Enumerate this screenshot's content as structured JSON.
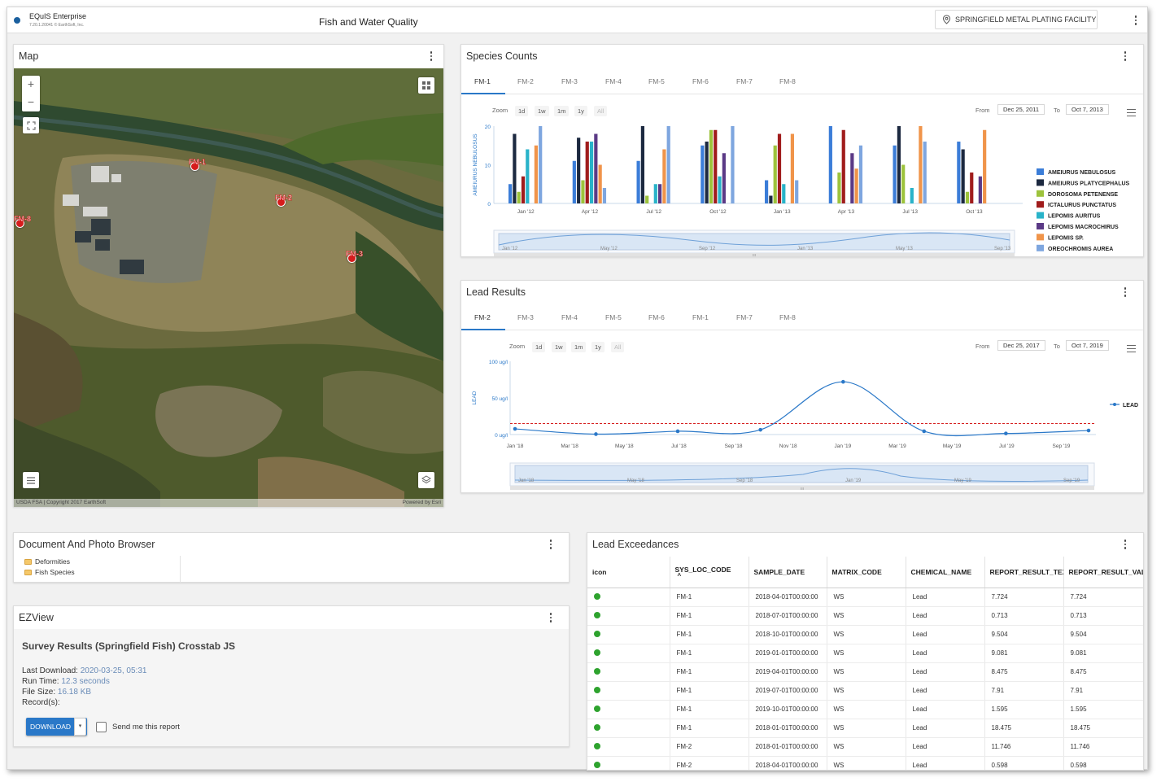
{
  "header": {
    "app_name": "EQuIS Enterprise",
    "app_version": "7.20.1.20041 © EarthSoft, Inc.",
    "page_title": "Fish and Water Quality",
    "facility": "SPRINGFIELD METAL PLATING FACILITY"
  },
  "map": {
    "title": "Map",
    "attribution_left": "USDA FSA | Copyright 2017 EarthSoft",
    "attribution_right": "Powered by Esri",
    "zoom_in": "+",
    "zoom_out": "−",
    "markers": [
      "FM-1",
      "FM-2",
      "FM-3",
      "FM-8"
    ]
  },
  "species": {
    "title": "Species Counts",
    "tabs": [
      "FM-1",
      "FM-2",
      "FM-3",
      "FM-4",
      "FM-5",
      "FM-6",
      "FM-7",
      "FM-8"
    ],
    "zoom_label": "Zoom",
    "zoom_buttons": [
      "1d",
      "1w",
      "1m",
      "1y",
      "All"
    ],
    "from_label": "From",
    "from_date": "Dec 25, 2011",
    "to_label": "To",
    "to_date": "Oct 7, 2013",
    "navigator_labels": [
      "Jan '12",
      "May '12",
      "Sep '12",
      "Jan '13",
      "May '13",
      "Sep '13"
    ],
    "navigator_scroll_label": "III"
  },
  "lead": {
    "title": "Lead Results",
    "tabs": [
      "FM-2",
      "FM-3",
      "FM-4",
      "FM-5",
      "FM-6",
      "FM-1",
      "FM-7",
      "FM-8"
    ],
    "zoom_label": "Zoom",
    "zoom_buttons": [
      "1d",
      "1w",
      "1m",
      "1y",
      "All"
    ],
    "from_label": "From",
    "from_date": "Dec 25, 2017",
    "to_label": "To",
    "to_date": "Oct 7, 2019",
    "navigator_labels": [
      "Jan '18",
      "May '18",
      "Sep '18",
      "Jan '19",
      "May '19",
      "Sep '19"
    ],
    "navigator_scroll_label": "III"
  },
  "chart_data": [
    {
      "type": "bar",
      "title": "",
      "ylabel": "AMEIURUS NEBULOSUS",
      "ylim": [
        0,
        20
      ],
      "yticks": [
        0,
        10,
        20
      ],
      "categories": [
        "Jan '12",
        "Apr '12",
        "Jul '12",
        "Oct '12",
        "Jan '13",
        "Apr '13",
        "Jul '13",
        "Oct '13"
      ],
      "legend_position": "right",
      "series": [
        {
          "name": "AMEIURUS NEBULOSUS",
          "color": "#3b7dd8",
          "values": [
            5,
            11,
            11,
            15,
            6,
            20,
            15,
            16
          ]
        },
        {
          "name": "AMEIURUS PLATYCEPHALUS",
          "color": "#1c2940",
          "values": [
            18,
            17,
            20,
            16,
            2,
            0,
            20,
            14
          ]
        },
        {
          "name": "DOROSOMA PETENENSE",
          "color": "#9dc33c",
          "values": [
            3,
            6,
            2,
            19,
            15,
            8,
            10,
            3
          ]
        },
        {
          "name": "ICTALURUS PUNCTATUS",
          "color": "#a01c1c",
          "values": [
            7,
            16,
            0,
            19,
            18,
            19,
            0,
            8
          ]
        },
        {
          "name": "LEPOMIS AURITUS",
          "color": "#29b3c9",
          "values": [
            14,
            16,
            5,
            7,
            5,
            0,
            4,
            0
          ]
        },
        {
          "name": "LEPOMIS MACROCHIRUS",
          "color": "#5b3a86",
          "values": [
            0,
            18,
            5,
            13,
            0,
            13,
            0,
            7
          ]
        },
        {
          "name": "LEPOMIS SP.",
          "color": "#f0944a",
          "values": [
            15,
            10,
            14,
            0,
            18,
            9,
            20,
            19
          ]
        },
        {
          "name": "OREOCHROMIS AUREA",
          "color": "#7ea6df",
          "values": [
            20,
            4,
            20,
            20,
            6,
            15,
            16,
            0
          ]
        }
      ]
    },
    {
      "type": "line",
      "title": "",
      "ylabel": "LEAD",
      "yticks": [
        "0 ug/l",
        "50 ug/l",
        "100 ug/l"
      ],
      "ylim": [
        0,
        100
      ],
      "x": [
        "Jan '18",
        "Mar '18",
        "May '18",
        "Jul '18",
        "Sep '18",
        "Nov '18",
        "Jan '19",
        "Mar '19",
        "May '19",
        "Jul '19",
        "Sep '19"
      ],
      "legend_position": "right",
      "threshold": 15,
      "series": [
        {
          "name": "LEAD",
          "color": "#2a78c8",
          "points": [
            {
              "x": "2018-01-01",
              "y": 7.724
            },
            {
              "x": "2018-04-01",
              "y": 0.598
            },
            {
              "x": "2018-07-01",
              "y": 4.5
            },
            {
              "x": "2018-10-01",
              "y": 6.5
            },
            {
              "x": "2019-01-01",
              "y": 72
            },
            {
              "x": "2019-04-01",
              "y": 4.5
            },
            {
              "x": "2019-07-01",
              "y": 1.5
            },
            {
              "x": "2019-10-01",
              "y": 5.5
            }
          ]
        }
      ]
    }
  ],
  "docs": {
    "title": "Document And Photo Browser",
    "folders": [
      "Deformities",
      "Fish Species"
    ]
  },
  "ezview": {
    "title": "EZView",
    "report_title": "Survey Results (Springfield Fish) Crosstab JS",
    "last_download_label": "Last Download:",
    "last_download_value": "2020-03-25, 05:31",
    "run_time_label": "Run Time:",
    "run_time_value": "12.3 seconds",
    "file_size_label": "File Size:",
    "file_size_value": "16.18 KB",
    "records_label": "Record(s):",
    "download_label": "DOWNLOAD",
    "send_label": "Send me this report"
  },
  "exceed": {
    "title": "Lead Exceedances",
    "columns": [
      "icon",
      "SYS_LOC_CODE",
      "SAMPLE_DATE",
      "MATRIX_CODE",
      "CHEMICAL_NAME",
      "REPORT_RESULT_TEXT",
      "REPORT_RESULT_VALUE"
    ],
    "rows": [
      [
        "FM-1",
        "2018-04-01T00:00:00",
        "WS",
        "Lead",
        "7.724",
        "7.724"
      ],
      [
        "FM-1",
        "2018-07-01T00:00:00",
        "WS",
        "Lead",
        "0.713",
        "0.713"
      ],
      [
        "FM-1",
        "2018-10-01T00:00:00",
        "WS",
        "Lead",
        "9.504",
        "9.504"
      ],
      [
        "FM-1",
        "2019-01-01T00:00:00",
        "WS",
        "Lead",
        "9.081",
        "9.081"
      ],
      [
        "FM-1",
        "2019-04-01T00:00:00",
        "WS",
        "Lead",
        "8.475",
        "8.475"
      ],
      [
        "FM-1",
        "2019-07-01T00:00:00",
        "WS",
        "Lead",
        "7.91",
        "7.91"
      ],
      [
        "FM-1",
        "2019-10-01T00:00:00",
        "WS",
        "Lead",
        "1.595",
        "1.595"
      ],
      [
        "FM-1",
        "2018-01-01T00:00:00",
        "WS",
        "Lead",
        "18.475",
        "18.475"
      ],
      [
        "FM-2",
        "2018-01-01T00:00:00",
        "WS",
        "Lead",
        "11.746",
        "11.746"
      ],
      [
        "FM-2",
        "2018-04-01T00:00:00",
        "WS",
        "Lead",
        "0.598",
        "0.598"
      ]
    ]
  },
  "colors": {
    "accent": "#2a78c8",
    "threshold": "#d62020",
    "status_ok": "#2ea32e"
  }
}
